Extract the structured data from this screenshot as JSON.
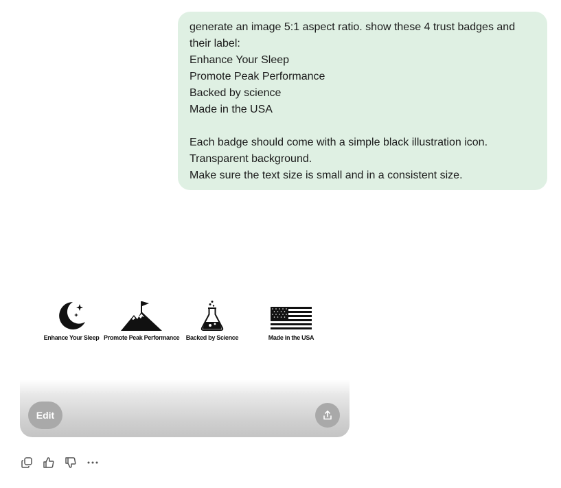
{
  "user_message": {
    "lines": [
      "generate an image 5:1 aspect ratio. show these 4 trust badges and",
      "their label:",
      "Enhance Your Sleep",
      "Promote Peak Performance",
      "Backed by science",
      "Made in the USA",
      "",
      "Each badge should come with a simple black illustration icon.",
      "Transparent background.",
      "Make sure the text size is small and in a consistent size."
    ]
  },
  "generated_image": {
    "badges": [
      {
        "icon": "moon-stars-icon",
        "label": "Enhance Your Sleep"
      },
      {
        "icon": "mountain-flag-icon",
        "label": "Promote Peak Performance"
      },
      {
        "icon": "flask-icon",
        "label": "Backed by Science"
      },
      {
        "icon": "us-flag-icon",
        "label": "Made in the USA"
      }
    ],
    "edit_label": "Edit",
    "share_icon": "share-icon"
  },
  "actions": {
    "icons": [
      "copy-icon",
      "thumbs-up-icon",
      "thumbs-down-icon",
      "more-icon"
    ]
  },
  "colors": {
    "bubble_bg": "#dff0e3",
    "button_bg": "#a9a9a9"
  }
}
